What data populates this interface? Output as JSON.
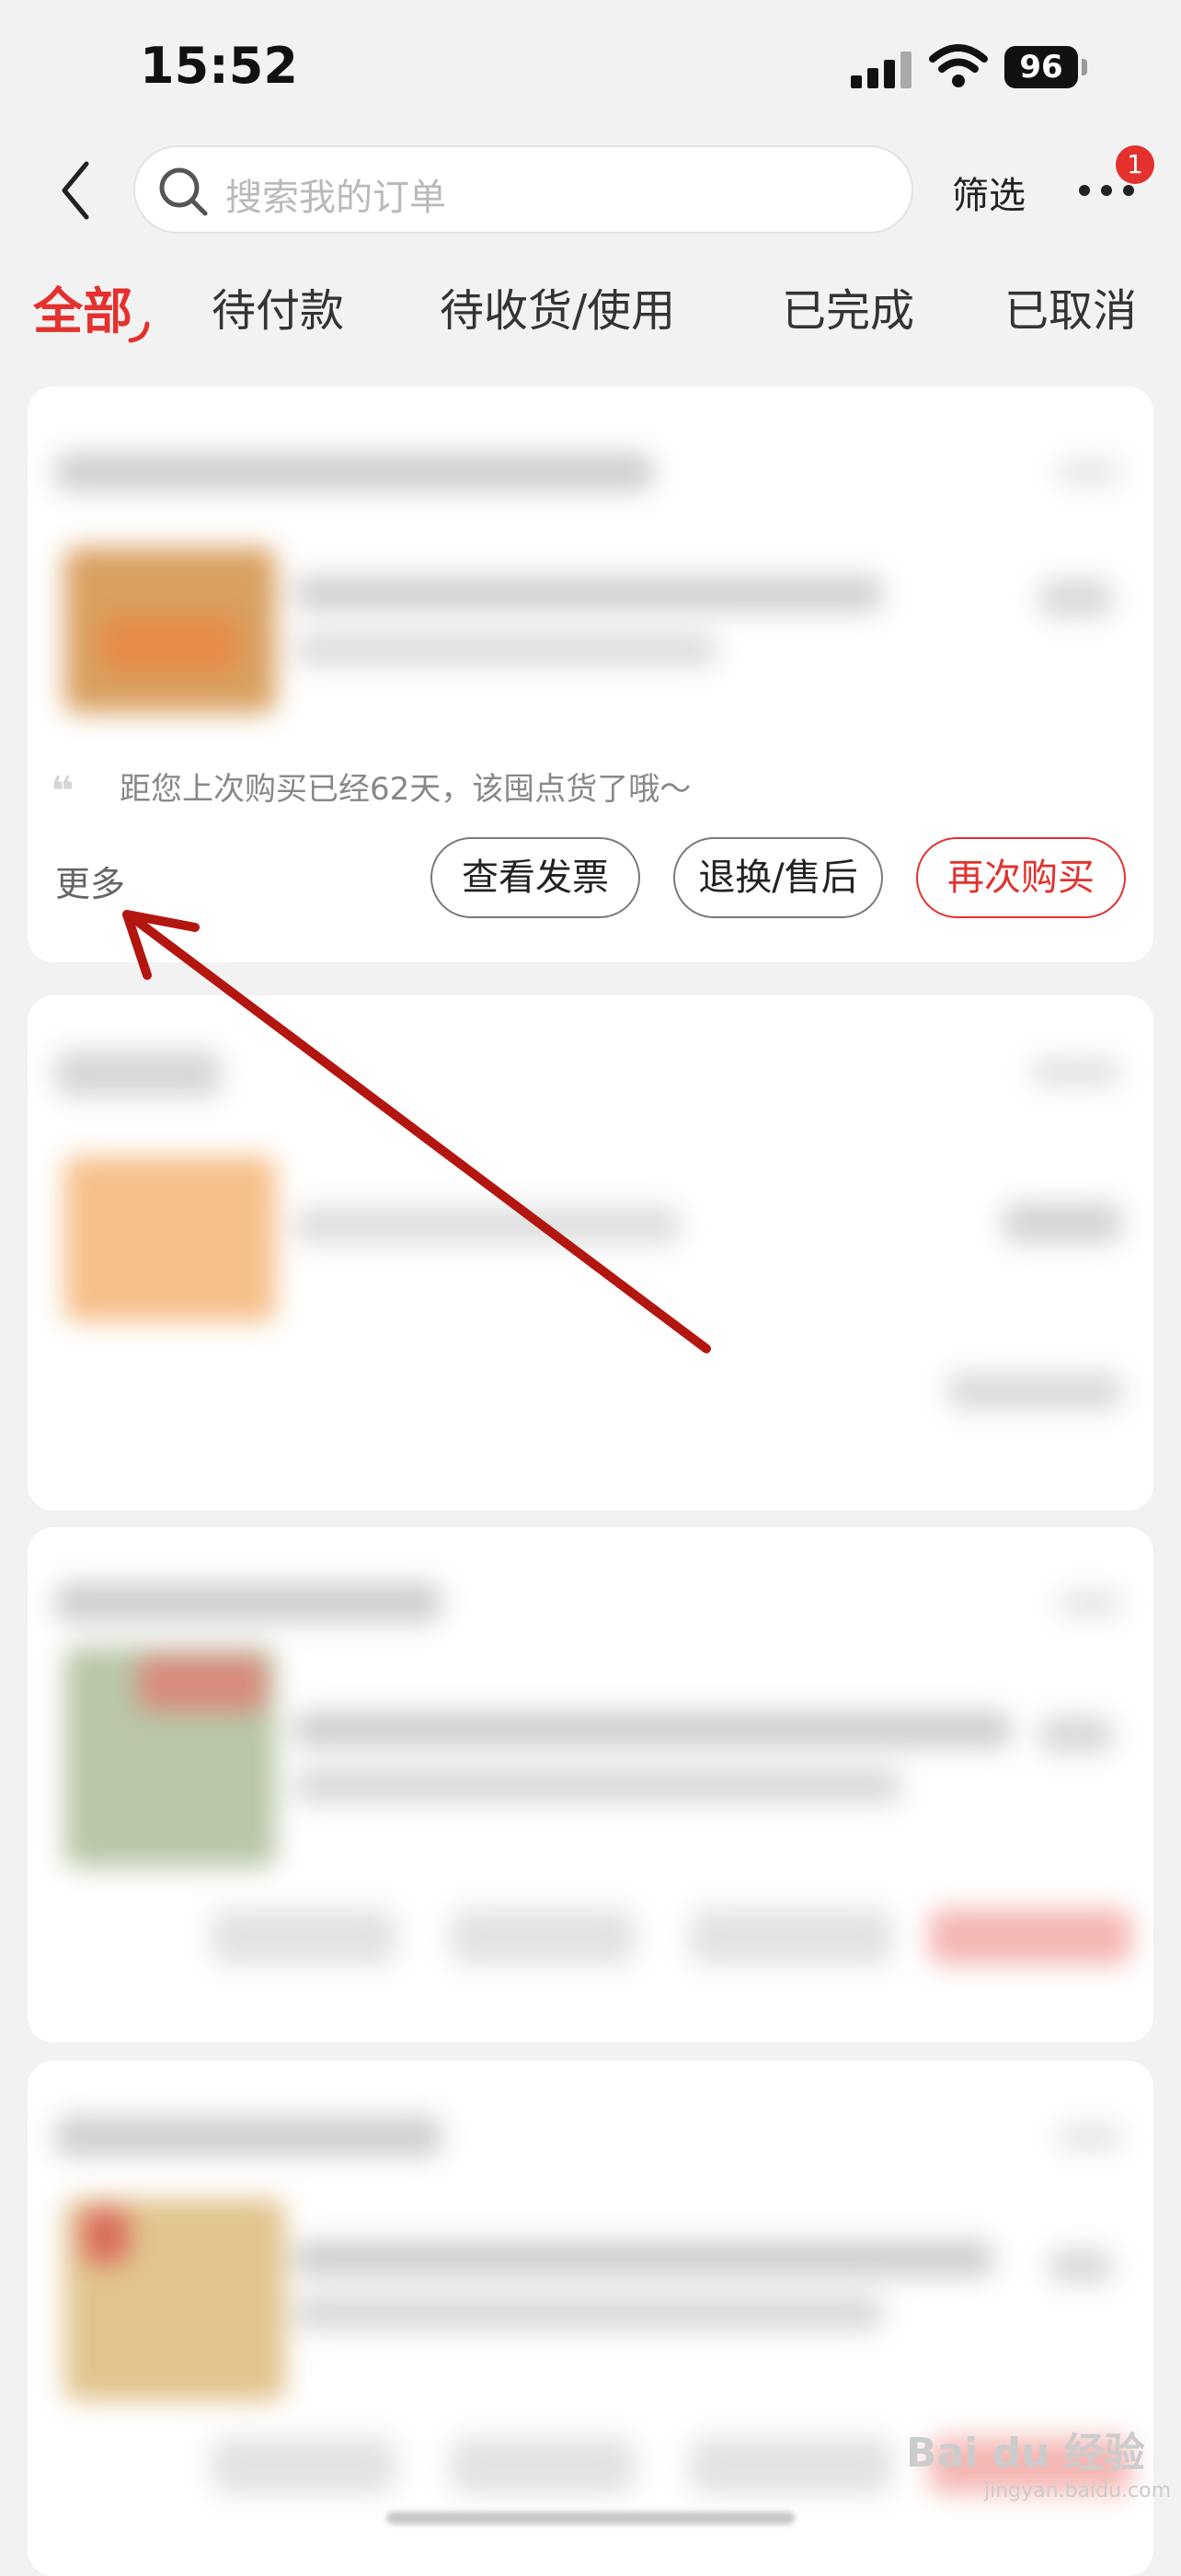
{
  "status_bar": {
    "time": "15:52",
    "battery": "96"
  },
  "header": {
    "search_placeholder": "搜索我的订单",
    "filter_label": "筛选",
    "notification_count": "1"
  },
  "tabs": [
    {
      "label": "全部"
    },
    {
      "label": "待付款"
    },
    {
      "label": "待收货/使用"
    },
    {
      "label": "已完成"
    },
    {
      "label": "已取消"
    }
  ],
  "order_card": {
    "tip": "距您上次购买已经62天，该囤点货了哦～",
    "more_label": "更多",
    "buttons": {
      "invoice": "查看发票",
      "return": "退换/售后",
      "rebuy": "再次购买"
    }
  },
  "colors": {
    "accent": "#e4312d",
    "annotation_arrow": "#b3160f"
  },
  "watermark": {
    "brand": "Bai du 经验",
    "url": "jingyan.baidu.com"
  }
}
